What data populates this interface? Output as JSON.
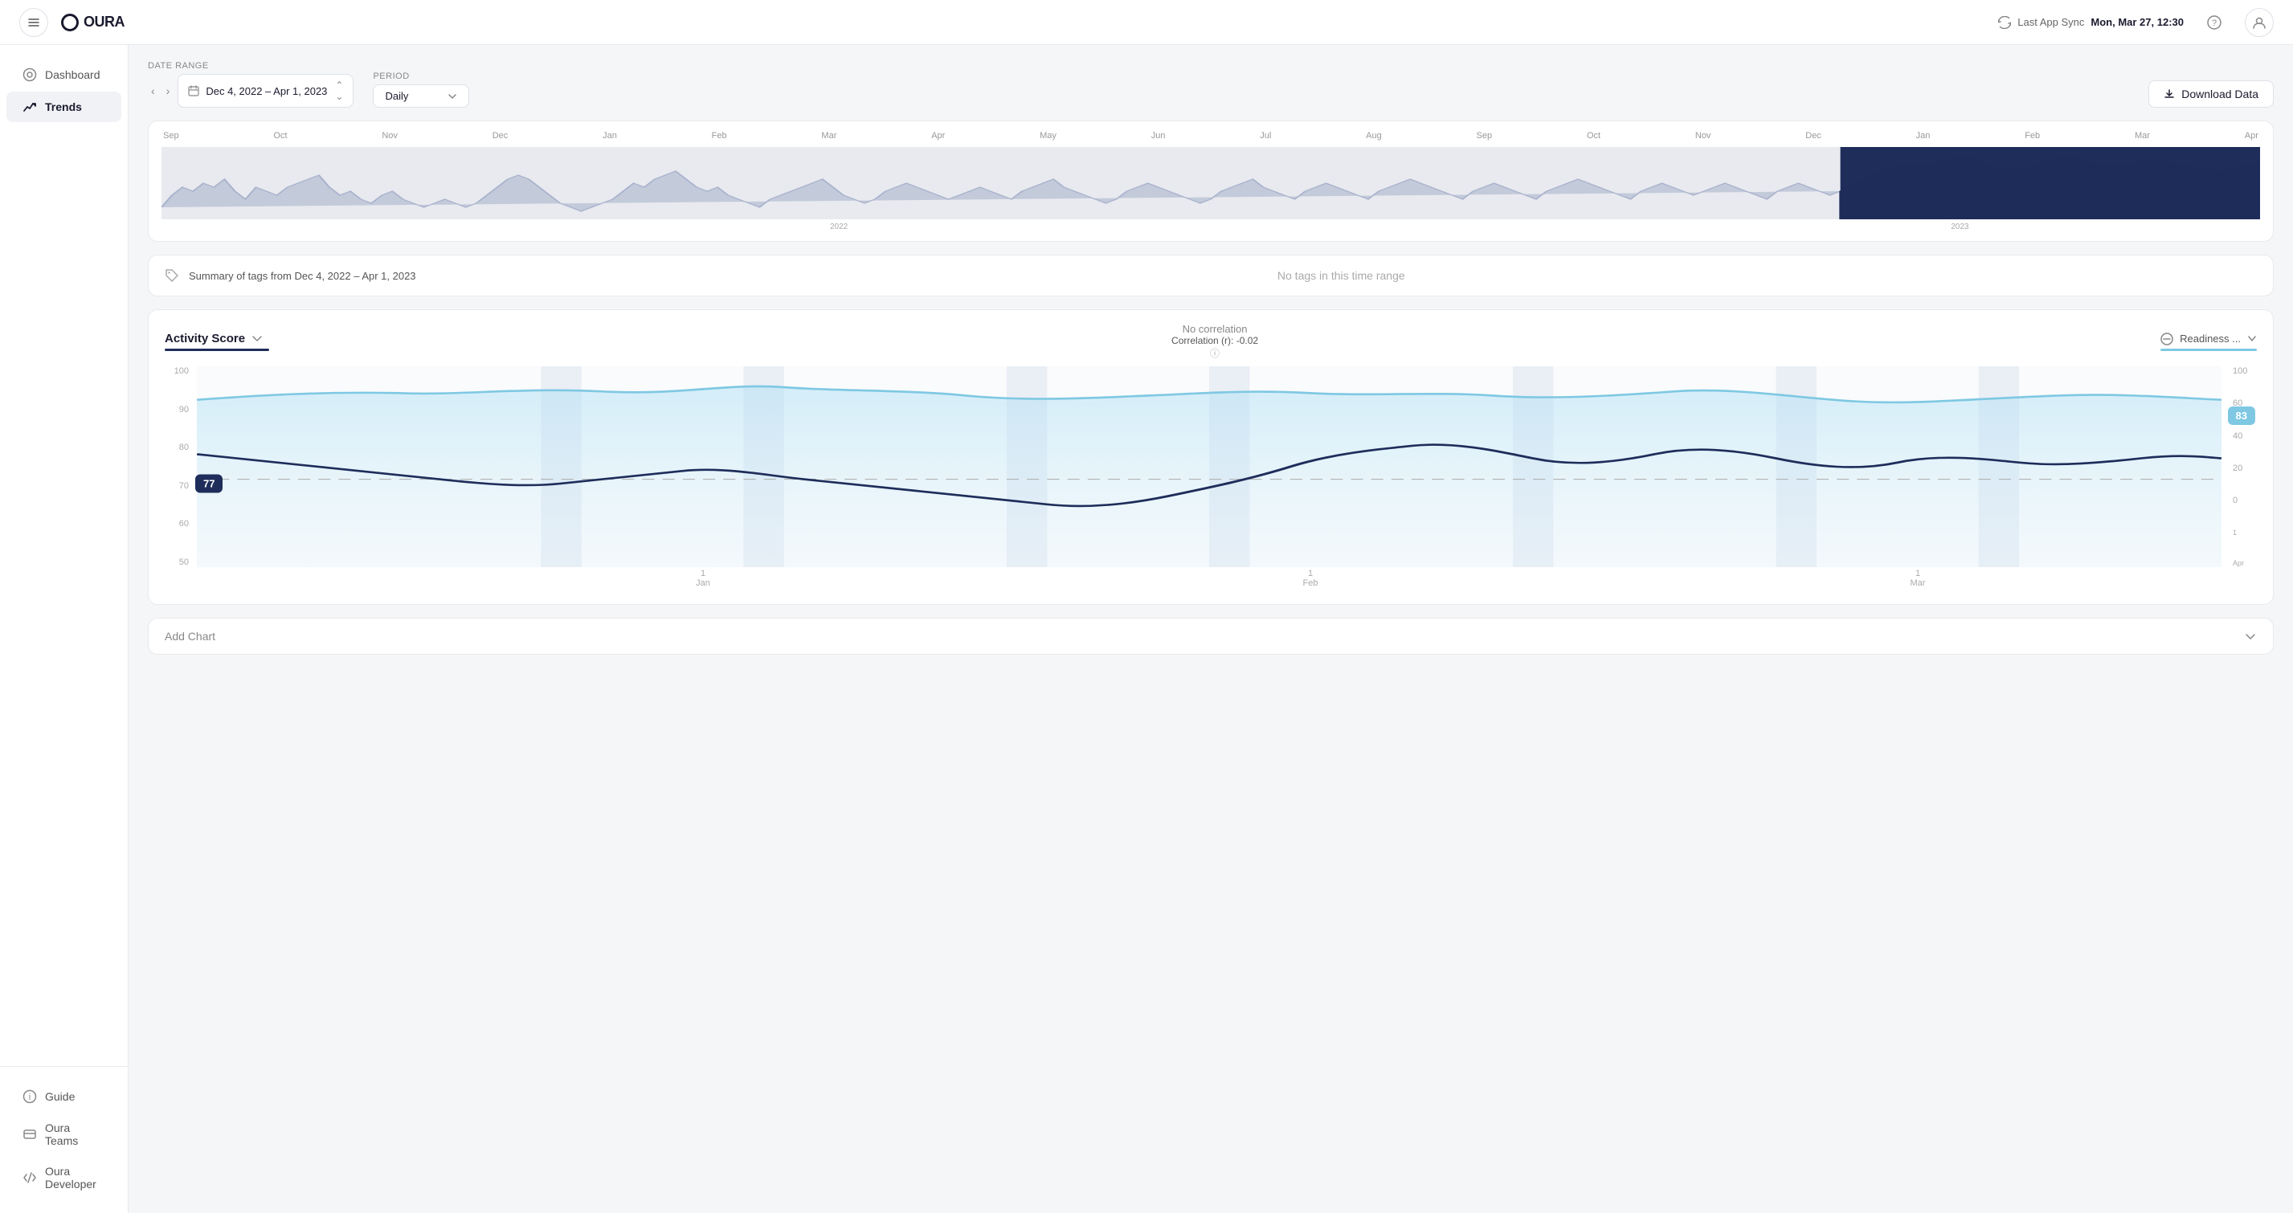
{
  "app": {
    "name": "OURA",
    "sync_label": "Last App Sync",
    "sync_time": "Mon, Mar 27, 12:30"
  },
  "sidebar": {
    "items": [
      {
        "id": "dashboard",
        "label": "Dashboard",
        "active": false
      },
      {
        "id": "trends",
        "label": "Trends",
        "active": true
      }
    ],
    "bottom_items": [
      {
        "id": "guide",
        "label": "Guide"
      },
      {
        "id": "oura-teams",
        "label": "Oura Teams"
      },
      {
        "id": "oura-developer",
        "label": "Oura Developer"
      }
    ]
  },
  "controls": {
    "date_range_label": "Date range",
    "date_range_value": "Dec 4, 2022 – Apr 1, 2023",
    "period_label": "Period",
    "period_value": "Daily",
    "download_label": "Download Data"
  },
  "overview": {
    "months": [
      "Sep",
      "Oct",
      "Nov",
      "Dec",
      "Jan",
      "Feb",
      "Mar",
      "Apr",
      "May",
      "Jun",
      "Jul",
      "Aug",
      "Sep",
      "Oct",
      "Nov",
      "Dec",
      "Jan",
      "Feb",
      "Mar",
      "Apr"
    ],
    "year_2022": "2022",
    "year_2023": "2023"
  },
  "tags_summary": {
    "title": "Summary of tags from Dec 4, 2022 – Apr 1, 2023",
    "empty_message": "No tags in this time range"
  },
  "chart": {
    "left_title": "Activity Score",
    "correlation_label": "No correlation",
    "correlation_value": "Correlation (r): -0.02",
    "right_label": "Readiness ...",
    "left_value": "77",
    "right_value": "83",
    "y_left": [
      "100",
      "90",
      "80",
      "70",
      "60",
      "50"
    ],
    "y_right": [
      "100",
      "60",
      "40",
      "20",
      "0"
    ],
    "x_labels": [
      {
        "num": "1",
        "month": "Jan"
      },
      {
        "num": "1",
        "month": "Feb"
      },
      {
        "num": "1",
        "month": "Mar"
      },
      {
        "num": "1",
        "month": "Apr"
      }
    ]
  },
  "add_chart": {
    "label": "Add Chart"
  }
}
